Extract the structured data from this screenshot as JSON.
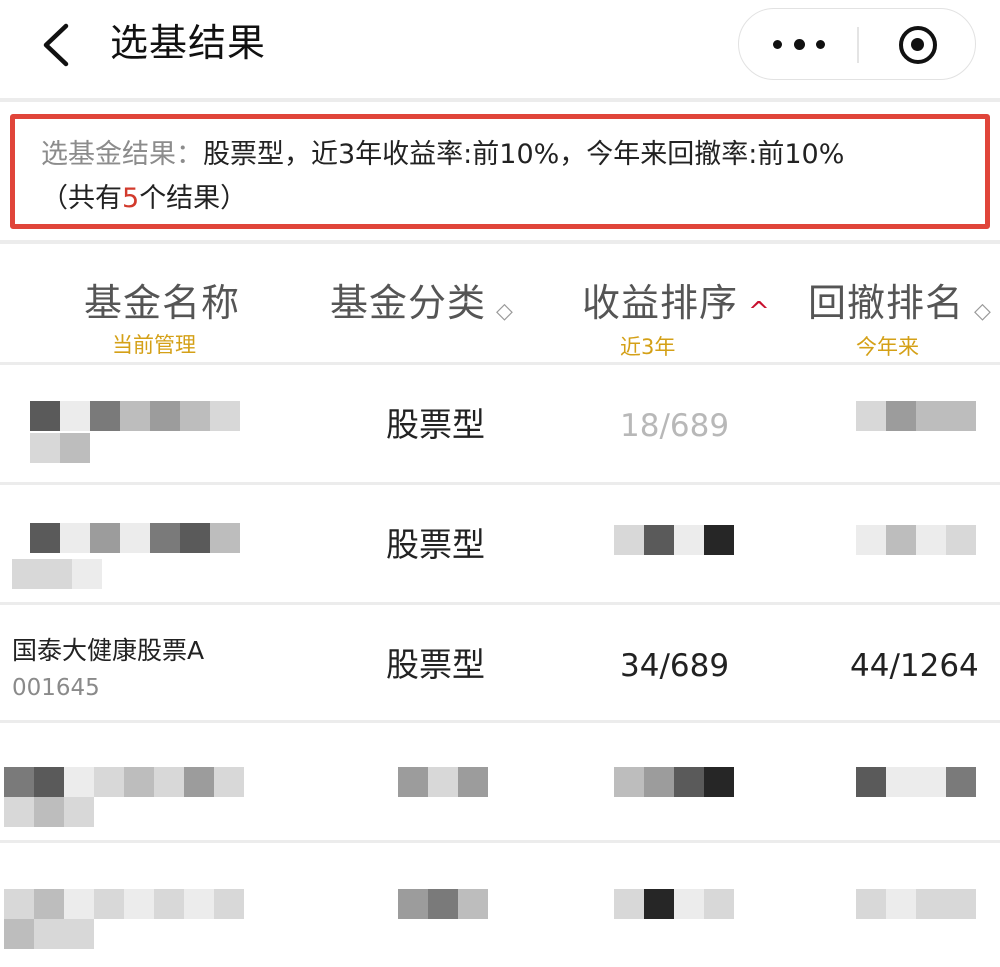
{
  "nav": {
    "title": "选基结果",
    "back_icon": "chevron-left-icon",
    "more_icon": "more-dots-icon",
    "close_icon": "target-circle-icon"
  },
  "summary": {
    "label": "选基金结果：",
    "criteria": "股票型，近3年收益率:前10%，今年来回撤率:前10%",
    "count_prefix": "（共有",
    "count": "5",
    "count_suffix": "个结果）",
    "border_color": "#e0453a"
  },
  "table": {
    "headers": [
      {
        "label": "基金名称",
        "sub": "当前管理",
        "sort": ""
      },
      {
        "label": "基金分类",
        "sub": "",
        "sort": "◇"
      },
      {
        "label": "收益排序",
        "sub": "近3年",
        "sort": "^"
      },
      {
        "label": "回撤排名",
        "sub": "今年来",
        "sort": "◇"
      }
    ],
    "rows": [
      {
        "name": "",
        "code": "",
        "category": "股票型",
        "return_rank": "18/689",
        "drawdown_rank": ""
      },
      {
        "name": "",
        "code": "",
        "category": "股票型",
        "return_rank": "",
        "drawdown_rank": ""
      },
      {
        "name": "国泰大健康股票A",
        "code": "001645",
        "category": "股票型",
        "return_rank": "34/689",
        "drawdown_rank": "44/1264"
      },
      {
        "name": "",
        "code": "",
        "category": "",
        "return_rank": "",
        "drawdown_rank": ""
      },
      {
        "name": "",
        "code": "",
        "category": "",
        "return_rank": "",
        "drawdown_rank": ""
      }
    ]
  },
  "colors": {
    "accent_red": "#c8102e",
    "sub_label_gold": "#d4a017",
    "count_red": "#d23a2c"
  }
}
